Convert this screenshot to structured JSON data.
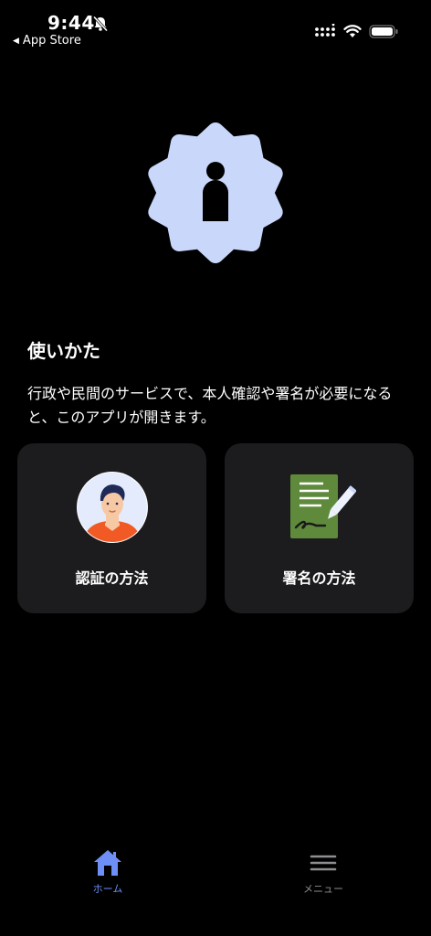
{
  "status_bar": {
    "time": "9:44",
    "back_label": "App Store"
  },
  "main": {
    "title": "使いかた",
    "description": "行政や民間のサービスで、本人確認や署名が必要になると、このアプリが開きます。",
    "cards": [
      {
        "label": "認証の方法",
        "icon": "person-avatar-icon"
      },
      {
        "label": "署名の方法",
        "icon": "signature-document-icon"
      }
    ]
  },
  "tabbar": {
    "items": [
      {
        "label": "ホーム",
        "icon": "home-icon",
        "active": true
      },
      {
        "label": "メニュー",
        "icon": "menu-icon",
        "active": false
      }
    ]
  },
  "colors": {
    "accent": "#6e8ff5",
    "badge_fill": "#c9d7fb",
    "card_bg": "#1c1c1e",
    "inactive": "#8e8e93"
  }
}
